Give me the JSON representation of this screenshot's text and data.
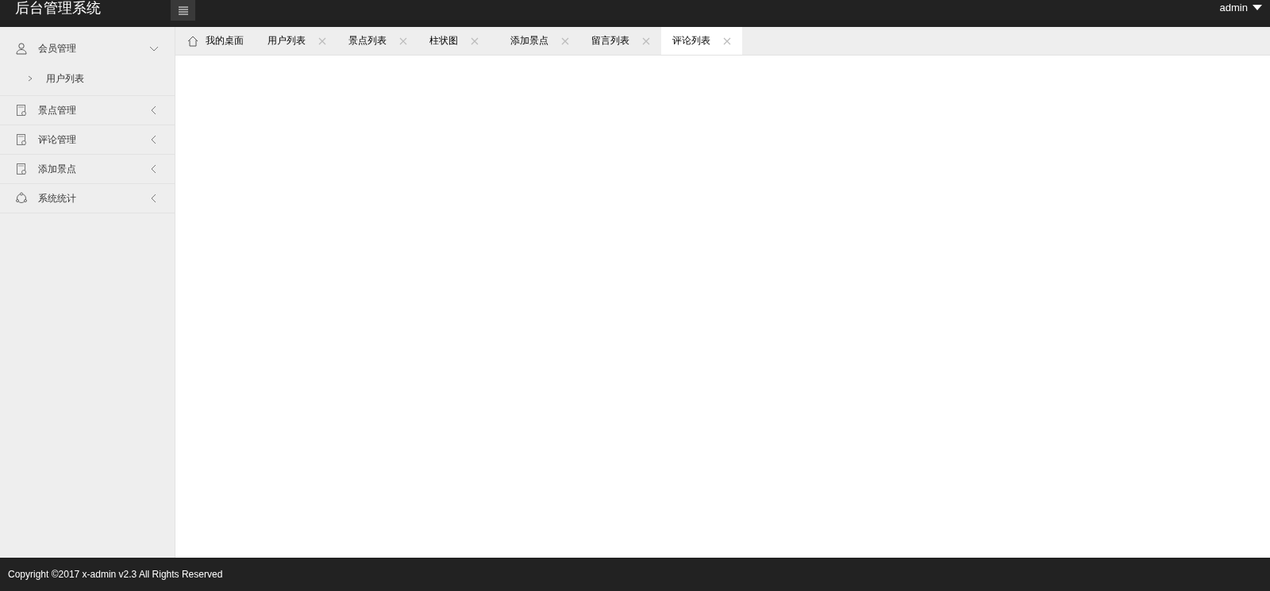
{
  "header": {
    "title": "后台管理系统",
    "user": "admin"
  },
  "sidebar": {
    "items": [
      {
        "label": "会员管理",
        "kind": "user",
        "expanded": true,
        "children": [
          {
            "label": "用户列表"
          }
        ]
      },
      {
        "label": "景点管理",
        "kind": "page",
        "expanded": false
      },
      {
        "label": "评论管理",
        "kind": "page",
        "expanded": false
      },
      {
        "label": "添加景点",
        "kind": "page",
        "expanded": false
      },
      {
        "label": "系统统计",
        "kind": "stats",
        "expanded": false
      }
    ]
  },
  "tabs": [
    {
      "label": "我的桌面",
      "kind": "home",
      "selected": false
    },
    {
      "label": "用户列表",
      "kind": "closable",
      "selected": false
    },
    {
      "label": "景点列表",
      "kind": "closable",
      "selected": false
    },
    {
      "label": "柱状图",
      "kind": "closable",
      "selected": false
    },
    {
      "label": "添加景点",
      "kind": "closable",
      "selected": false
    },
    {
      "label": "留言列表",
      "kind": "closable",
      "selected": false
    },
    {
      "label": "评论列表",
      "kind": "closable",
      "selected": true
    }
  ],
  "footer": {
    "text": "Copyright ©2017 x-admin v2.3 All Rights Reserved"
  }
}
